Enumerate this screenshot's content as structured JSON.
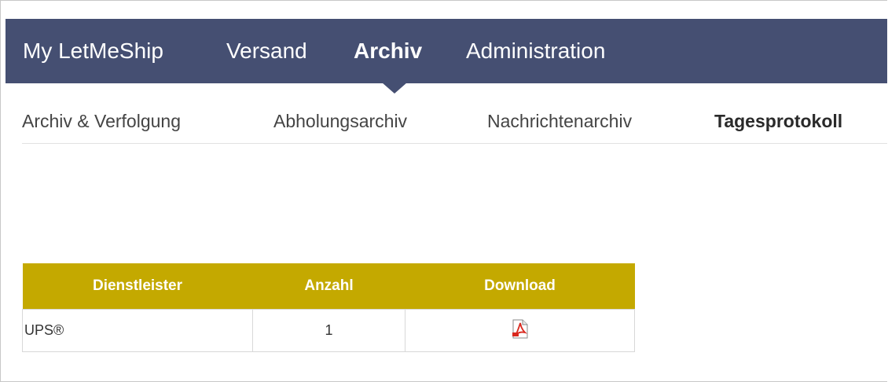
{
  "top_nav": {
    "items": [
      {
        "label": "My LetMeShip",
        "active": false
      },
      {
        "label": "Versand",
        "active": false
      },
      {
        "label": "Archiv",
        "active": true
      },
      {
        "label": "Administration",
        "active": false
      }
    ]
  },
  "sub_nav": {
    "items": [
      {
        "label": "Archiv & Verfolgung",
        "active": false
      },
      {
        "label": "Abholungsarchiv",
        "active": false
      },
      {
        "label": "Nachrichtenarchiv",
        "active": false
      },
      {
        "label": "Tagesprotokoll",
        "active": true
      }
    ]
  },
  "table": {
    "headers": [
      "Dienstleister",
      "Anzahl",
      "Download"
    ],
    "rows": [
      {
        "provider": "UPS®",
        "count": "1",
        "download_icon": "pdf-icon"
      }
    ]
  },
  "colors": {
    "nav_background": "#454f72",
    "table_header": "#c4a900",
    "pdf_icon": "#d9281e"
  }
}
